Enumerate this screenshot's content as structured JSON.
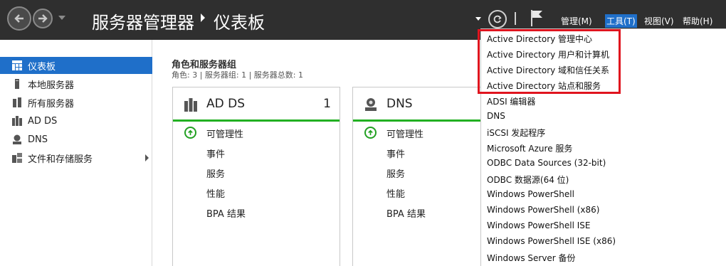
{
  "titlebar": {
    "app_title": "服务器管理器",
    "page_title": "仪表板",
    "menus": {
      "manage": "管理(M)",
      "tools": "工具(T)",
      "view": "视图(V)",
      "help": "帮助(H)"
    }
  },
  "sidebar": {
    "items": [
      {
        "label": "仪表板",
        "icon": "dashboard-icon",
        "active": true
      },
      {
        "label": "本地服务器",
        "icon": "server-icon"
      },
      {
        "label": "所有服务器",
        "icon": "servers-icon"
      },
      {
        "label": "AD DS",
        "icon": "adds-icon"
      },
      {
        "label": "DNS",
        "icon": "dns-icon"
      },
      {
        "label": "文件和存储服务",
        "icon": "file-storage-icon",
        "expandable": true
      }
    ]
  },
  "main": {
    "section_title": "角色和服务器组",
    "section_subtitle": "角色: 3 | 服务器组: 1 | 服务器总数: 1",
    "tiles": [
      {
        "title": "AD DS",
        "count": "1",
        "rows": [
          "可管理性",
          "事件",
          "服务",
          "性能",
          "BPA 结果"
        ]
      },
      {
        "title": "DNS",
        "count": "",
        "rows": [
          "可管理性",
          "事件",
          "服务",
          "性能",
          "BPA 结果"
        ]
      }
    ]
  },
  "tools_menu": {
    "items": [
      "Active Directory 管理中心",
      "Active Directory 用户和计算机",
      "Active Directory 域和信任关系",
      "Active Directory 站点和服务",
      "ADSI 编辑器",
      "DNS",
      "iSCSI 发起程序",
      "Microsoft Azure 服务",
      "ODBC Data Sources (32-bit)",
      "ODBC 数据源(64 位)",
      "Windows PowerShell",
      "Windows PowerShell (x86)",
      "Windows PowerShell ISE",
      "Windows PowerShell ISE (x86)",
      "Windows Server 备份"
    ]
  },
  "colors": {
    "titlebar_bg": "#2f2f2f",
    "accent": "#1f6fc9",
    "status_green": "#22b022",
    "highlight_red": "#e0141e"
  }
}
